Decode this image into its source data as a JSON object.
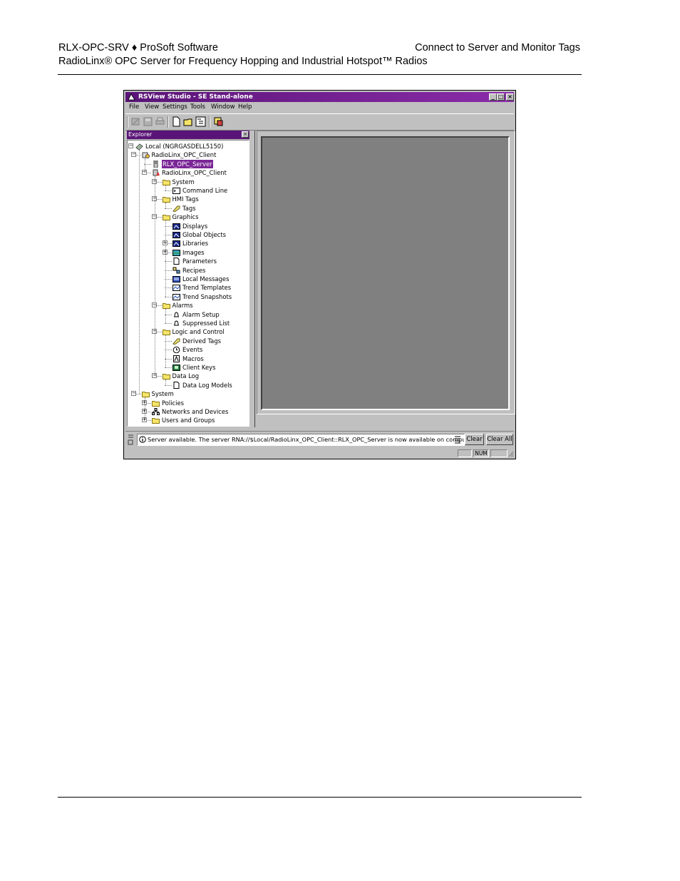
{
  "header": {
    "left_line1": "RLX-OPC-SRV ♦ ProSoft Software",
    "left_line2": "RadioLinx® OPC Server for Frequency Hopping and Industrial Hotspot™ Radios",
    "right_line1": "Connect to Server and Monitor Tags"
  },
  "window": {
    "title": "RSView Studio - SE Stand-alone",
    "menu": [
      "File",
      "View",
      "Settings",
      "Tools",
      "Window",
      "Help"
    ],
    "explorer_title": "Explorer",
    "tree": [
      {
        "label": "Local (NGRGASDELL5150)",
        "depth": 0,
        "expander": "−",
        "icon": "computer-icon"
      },
      {
        "label": "RadioLinx_OPC_Client",
        "depth": 1,
        "expander": "−",
        "icon": "application-icon"
      },
      {
        "label": "RLX_OPC_Server",
        "depth": 2,
        "expander": "",
        "icon": "server-icon",
        "selected": true
      },
      {
        "label": "RadioLinx_OPC_Client",
        "depth": 2,
        "expander": "−",
        "icon": "hmi-server-icon"
      },
      {
        "label": "System",
        "depth": 3,
        "expander": "−",
        "icon": "folder-icon"
      },
      {
        "label": "Command Line",
        "depth": 4,
        "expander": "",
        "icon": "command-line-icon"
      },
      {
        "label": "HMI Tags",
        "depth": 3,
        "expander": "−",
        "icon": "folder-icon"
      },
      {
        "label": "Tags",
        "depth": 4,
        "expander": "",
        "icon": "tag-icon"
      },
      {
        "label": "Graphics",
        "depth": 3,
        "expander": "−",
        "icon": "folder-icon"
      },
      {
        "label": "Displays",
        "depth": 4,
        "expander": "",
        "icon": "display-icon"
      },
      {
        "label": "Global Objects",
        "depth": 4,
        "expander": "",
        "icon": "display-icon"
      },
      {
        "label": "Libraries",
        "depth": 4,
        "expander": "+",
        "icon": "display-icon"
      },
      {
        "label": "Images",
        "depth": 4,
        "expander": "+",
        "icon": "image-icon"
      },
      {
        "label": "Parameters",
        "depth": 4,
        "expander": "",
        "icon": "document-icon"
      },
      {
        "label": "Recipes",
        "depth": 4,
        "expander": "",
        "icon": "recipe-icon"
      },
      {
        "label": "Local Messages",
        "depth": 4,
        "expander": "",
        "icon": "messages-icon"
      },
      {
        "label": "Trend Templates",
        "depth": 4,
        "expander": "",
        "icon": "trend-icon"
      },
      {
        "label": "Trend Snapshots",
        "depth": 4,
        "expander": "",
        "icon": "trend-icon"
      },
      {
        "label": "Alarms",
        "depth": 3,
        "expander": "−",
        "icon": "folder-icon"
      },
      {
        "label": "Alarm Setup",
        "depth": 4,
        "expander": "",
        "icon": "bell-icon"
      },
      {
        "label": "Suppressed List",
        "depth": 4,
        "expander": "",
        "icon": "bell-icon"
      },
      {
        "label": "Logic and Control",
        "depth": 3,
        "expander": "−",
        "icon": "folder-icon"
      },
      {
        "label": "Derived Tags",
        "depth": 4,
        "expander": "",
        "icon": "tag-icon"
      },
      {
        "label": "Events",
        "depth": 4,
        "expander": "",
        "icon": "clock-icon"
      },
      {
        "label": "Macros",
        "depth": 4,
        "expander": "",
        "icon": "macro-icon"
      },
      {
        "label": "Client Keys",
        "depth": 4,
        "expander": "",
        "icon": "key-icon"
      },
      {
        "label": "Data Log",
        "depth": 3,
        "expander": "−",
        "icon": "folder-icon"
      },
      {
        "label": "Data Log Models",
        "depth": 4,
        "expander": "",
        "icon": "document-icon"
      },
      {
        "label": "System",
        "depth": 1,
        "expander": "−",
        "icon": "folder-icon"
      },
      {
        "label": "Policies",
        "depth": 2,
        "expander": "+",
        "icon": "folder-icon"
      },
      {
        "label": "Networks and Devices",
        "depth": 2,
        "expander": "+",
        "icon": "network-icon"
      },
      {
        "label": "Users and Groups",
        "depth": 2,
        "expander": "+",
        "icon": "folder-icon"
      }
    ],
    "diagnostics_message": "Server available.  The server RNA://$Local/RadioLinx_OPC_Client::RLX_OPC_Server is now available on comput...",
    "clear_label": "Clear",
    "clear_all_label": "Clear All",
    "status_num": "NUM"
  }
}
